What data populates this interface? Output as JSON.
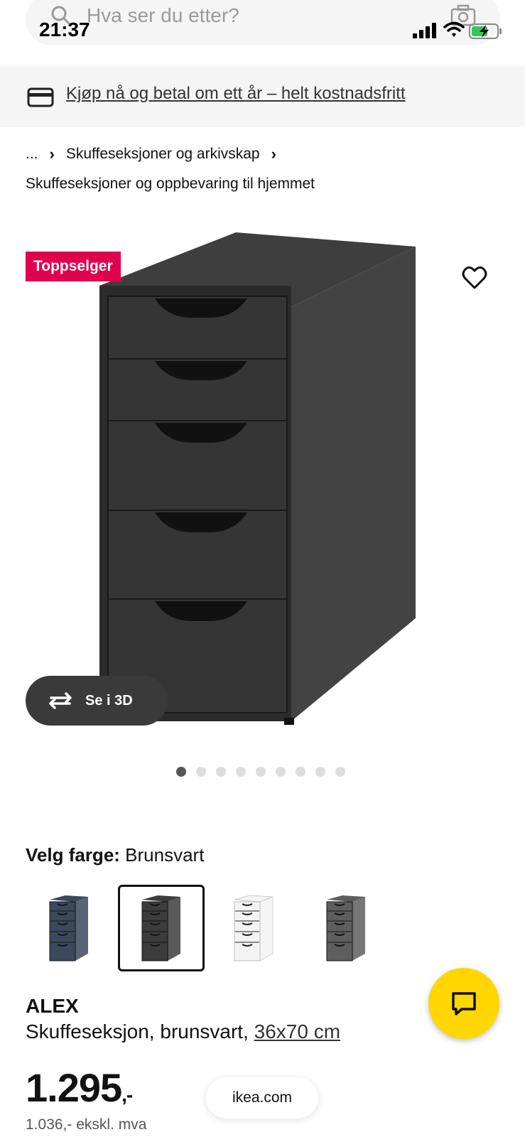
{
  "status_bar": {
    "time": "21:37"
  },
  "search": {
    "placeholder": "Hva ser du etter?"
  },
  "promo": {
    "text": "Kjøp nå og betal om ett år – helt kostnadsfritt"
  },
  "breadcrumb": {
    "ellipsis": "...",
    "category": "Skuffeseksjoner og arkivskap",
    "subcategory": "Skuffeseksjoner og oppbevaring til hjemmet"
  },
  "product_image": {
    "badge": "Toppselger",
    "view3d_label": "Se i 3D",
    "dot_count": 9,
    "active_dot": 1
  },
  "color": {
    "label": "Velg farge:",
    "selected": "Brunsvart",
    "swatches": [
      {
        "name": "blue",
        "color": "#3a4a5c"
      },
      {
        "name": "black-brown",
        "color": "#3c3c3c",
        "selected": true
      },
      {
        "name": "white",
        "color": "#f4f4f4"
      },
      {
        "name": "grey",
        "color": "#5e5e5e"
      }
    ]
  },
  "product": {
    "name": "ALEX",
    "description": "Skuffeseksjon, brunsvart,",
    "size": "36x70 cm",
    "price": "1.295",
    "price_suffix": ",-",
    "price_ex_vat": "1.036,- ekskl. mva"
  },
  "footer": {
    "domain": "ikea.com"
  },
  "colors": {
    "badge": "#e0004d",
    "chat": "#ffd600"
  }
}
